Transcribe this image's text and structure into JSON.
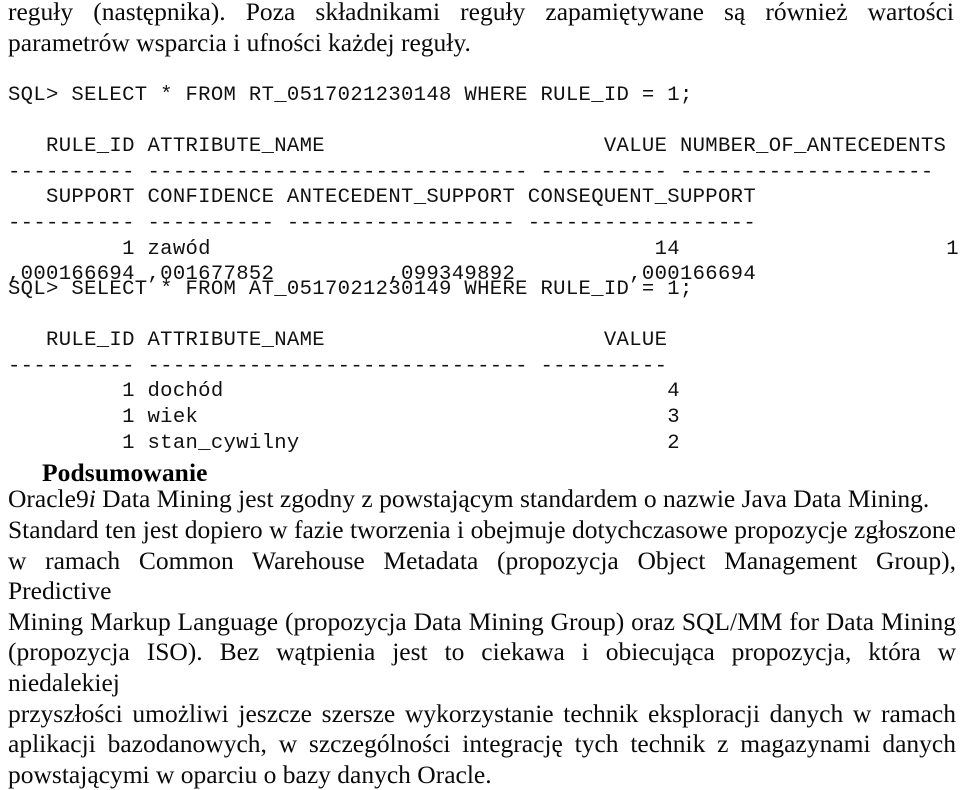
{
  "document": {
    "intro_paragraph": {
      "lines": [
        "reguły (następnika).  Poza  składnikami  reguły  zapamiętywane  są  również  wartości",
        "parametrów wsparcia i ufności każdej reguły."
      ]
    },
    "sql_block_1": {
      "prompt_line": "SQL> SELECT * FROM RT_0517021230148 WHERE RULE_ID = 1;",
      "header_line_1": "   RULE_ID ATTRIBUTE_NAME                      VALUE NUMBER_OF_ANTECEDENTS",
      "separator_line_1": "---------- ------------------------------ ---------- --------------------",
      "header_line_2": "   SUPPORT CONFIDENCE ANTECEDENT_SUPPORT CONSEQUENT_SUPPORT",
      "separator_line_2": "---------- ---------- ------------------ ------------------",
      "row_line_1": "         1 zawód                                   14                     1",
      "row_line_2": ",000166694 ,001677852         ,099349892         ,000166694",
      "table_name": "RT_0517021230148",
      "columns_top": [
        "RULE_ID",
        "ATTRIBUTE_NAME",
        "VALUE",
        "NUMBER_OF_ANTECEDENTS"
      ],
      "columns_bottom": [
        "SUPPORT",
        "CONFIDENCE",
        "ANTECEDENT_SUPPORT",
        "CONSEQUENT_SUPPORT"
      ],
      "row_values_top": [
        "1",
        "zawód",
        "14",
        "1"
      ],
      "row_values_bottom": [
        ",000166694",
        ",001677852",
        ",099349892",
        ",000166694"
      ]
    },
    "sql_block_2": {
      "prompt_line": "SQL> SELECT * FROM AT_0517021230149 WHERE RULE_ID = 1;",
      "header_line": "   RULE_ID ATTRIBUTE_NAME                      VALUE",
      "separator_line": "---------- ------------------------------ ----------",
      "row_lines": [
        "         1 dochód                                   4",
        "         1 wiek                                     3",
        "         1 stan_cywilny                             2"
      ],
      "table_name": "AT_0517021230149",
      "columns": [
        "RULE_ID",
        "ATTRIBUTE_NAME",
        "VALUE"
      ],
      "rows": [
        [
          "1",
          "dochód",
          "4"
        ],
        [
          "1",
          "wiek",
          "3"
        ],
        [
          "1",
          "stan_cywilny",
          "2"
        ]
      ]
    },
    "summary": {
      "heading": "Podsumowanie",
      "first_line_prefix": "Oracle9",
      "first_line_italic": "i",
      "first_line_rest": " Data Mining jest zgodny z powstającym standardem o nazwie Java Data Mining.",
      "lines": [
        "Standard ten jest dopiero w fazie tworzenia i obejmuje dotychczasowe propozycje zgłoszone",
        "w ramach Common Warehouse Metadata (propozycja Object Management Group), Predictive",
        "Mining Markup Language (propozycja Data Mining Group) oraz SQL/MM for Data Mining",
        "(propozycja ISO).  Bez wątpienia jest to ciekawa i obiecująca propozycja, która w niedalekiej",
        "przyszłości  umożliwi  jeszcze  szersze  wykorzystanie  technik  eksploracji  danych  w  ramach",
        "aplikacji  bazodanowych,  w  szczególności  integrację  tych  technik  z  magazynami  danych",
        "powstającymi w oparciu o bazy danych Oracle."
      ]
    }
  }
}
